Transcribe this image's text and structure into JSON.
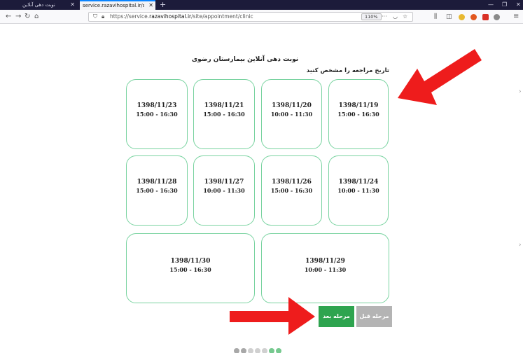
{
  "browser": {
    "tabs": [
      {
        "title": "نوبت دهی آنلاین",
        "active": false
      },
      {
        "title": "service.razavihospital.ir/site/appoin",
        "active": true
      }
    ],
    "url_prefix": "https://service.",
    "url_domain": "razavihospital.ir",
    "url_path": "/site/appointment/clinic",
    "zoom": "110%",
    "more_label": "···"
  },
  "page": {
    "heading": "نوبت دهی آنلاین بیمارستان رضوی",
    "subheading": "تاریخ مراجعه را مشخص کنید"
  },
  "slots": [
    {
      "date": "1398/11/19",
      "time": "15:00 - 16:30"
    },
    {
      "date": "1398/11/20",
      "time": "10:00 - 11:30"
    },
    {
      "date": "1398/11/21",
      "time": "15:00 - 16:30"
    },
    {
      "date": "1398/11/23",
      "time": "15:00 - 16:30"
    },
    {
      "date": "1398/11/24",
      "time": "10:00 - 11:30"
    },
    {
      "date": "1398/11/26",
      "time": "15:00 - 16:30"
    },
    {
      "date": "1398/11/27",
      "time": "10:00 - 11:30"
    },
    {
      "date": "1398/11/28",
      "time": "15:00 - 16:30"
    },
    {
      "date": "1398/11/29",
      "time": "10:00 - 11:30"
    },
    {
      "date": "1398/11/30",
      "time": "15:00 - 16:30"
    }
  ],
  "buttons": {
    "next": "مرحله بعد",
    "prev": "مرحله قبل"
  },
  "colors": {
    "card_border": "#79d3a0",
    "next_button": "#2ea44f",
    "prev_button": "#b4b4b4",
    "annotation_arrow": "#ee1c1c"
  },
  "step_indicator": {
    "total": 7,
    "completed": 5
  }
}
